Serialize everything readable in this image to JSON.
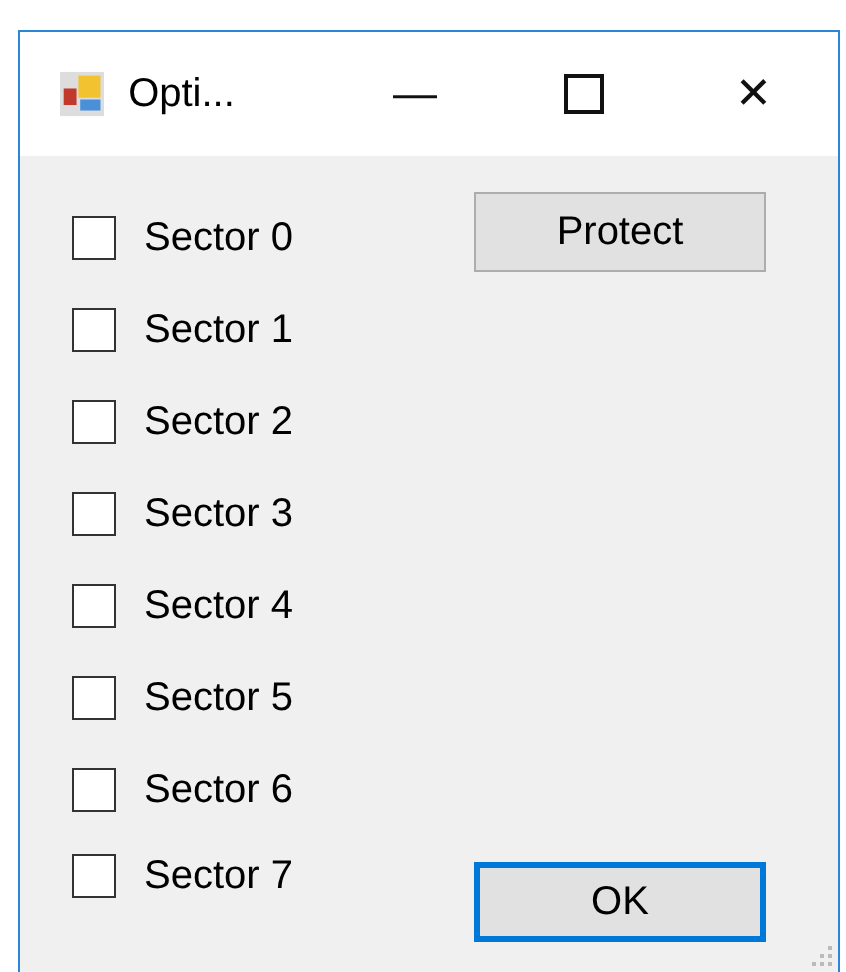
{
  "window": {
    "title": "Opti..."
  },
  "title_buttons": {
    "minimize": "—",
    "close": "✕"
  },
  "sectors": [
    {
      "label": "Sector 0",
      "checked": false
    },
    {
      "label": "Sector 1",
      "checked": false
    },
    {
      "label": "Sector 2",
      "checked": false
    },
    {
      "label": "Sector 3",
      "checked": false
    },
    {
      "label": "Sector 4",
      "checked": false
    },
    {
      "label": "Sector 5",
      "checked": false
    },
    {
      "label": "Sector 6",
      "checked": false
    },
    {
      "label": "Sector 7",
      "checked": false
    }
  ],
  "buttons": [
    {
      "label": "Protect",
      "default": false
    },
    {
      "label": "OK",
      "default": true
    }
  ]
}
